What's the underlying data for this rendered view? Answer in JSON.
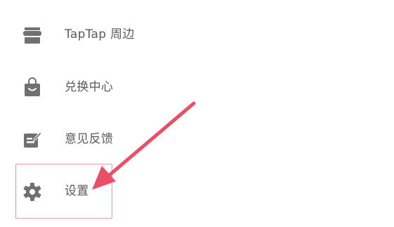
{
  "menu": {
    "items": [
      {
        "label": "TapTap 周边",
        "icon": "store-icon"
      },
      {
        "label": "兑换中心",
        "icon": "shopping-bag-icon"
      },
      {
        "label": "意见反馈",
        "icon": "feedback-icon"
      },
      {
        "label": "设置",
        "icon": "gear-icon"
      }
    ]
  },
  "annotation": {
    "highlight_color": "#e99a9d",
    "arrow_color": "#ea4f68"
  },
  "colors": {
    "icon": "#707070",
    "label": "#5a5a5a",
    "background": "#ffffff"
  }
}
